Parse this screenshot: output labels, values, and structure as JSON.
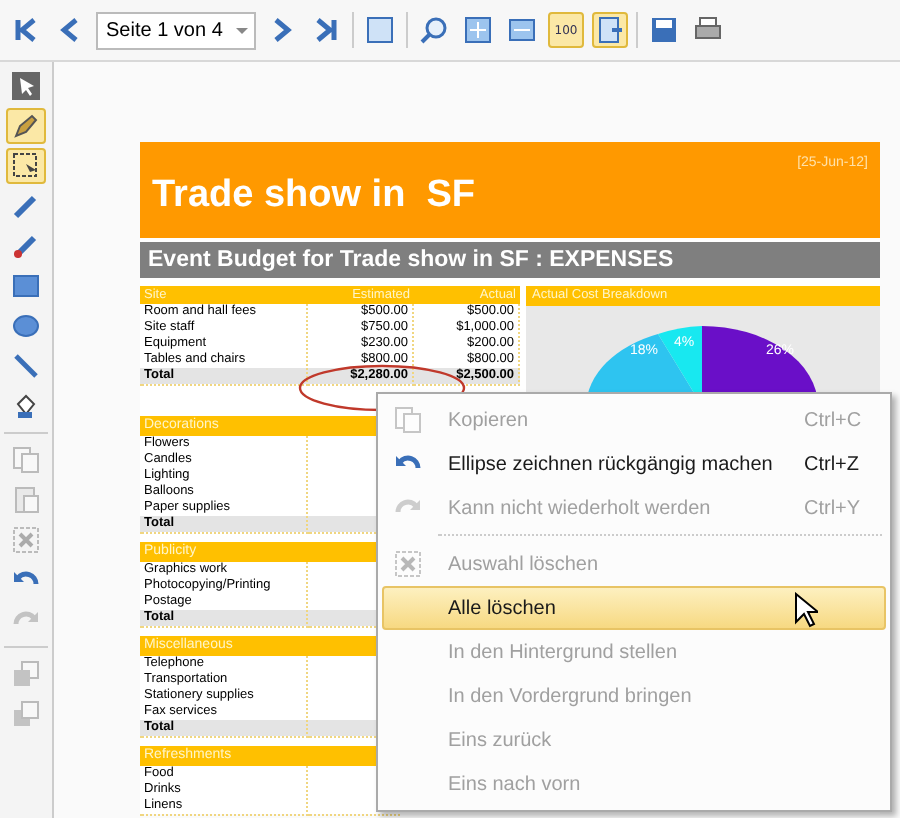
{
  "toolbar": {
    "page_select": {
      "value": "Seite 1 von 4"
    },
    "tools": [
      {
        "kind": "first",
        "selected": false
      },
      {
        "kind": "prev",
        "selected": false
      },
      {
        "kind": "page"
      },
      {
        "kind": "next",
        "selected": false
      },
      {
        "kind": "last",
        "selected": false
      },
      {
        "kind": "sep"
      },
      {
        "kind": "fitpage",
        "selected": false
      },
      {
        "kind": "sep"
      },
      {
        "kind": "zoom",
        "selected": false
      },
      {
        "kind": "fitall",
        "selected": false
      },
      {
        "kind": "fitwidth",
        "selected": false
      },
      {
        "kind": "actual",
        "selected": true,
        "label": "100"
      },
      {
        "kind": "autofit",
        "selected": true
      },
      {
        "kind": "sep"
      },
      {
        "kind": "save",
        "selected": false
      },
      {
        "kind": "print",
        "selected": false
      }
    ]
  },
  "side_tools": [
    {
      "kind": "pointer",
      "selected": false,
      "disabled": false
    },
    {
      "kind": "pen",
      "selected": true,
      "disabled": false
    },
    {
      "kind": "select",
      "selected": true,
      "disabled": false
    },
    {
      "kind": "pencil",
      "selected": false,
      "disabled": false
    },
    {
      "kind": "marker",
      "selected": false,
      "disabled": false
    },
    {
      "kind": "rect",
      "selected": false,
      "disabled": false
    },
    {
      "kind": "ellipse",
      "selected": false,
      "disabled": false
    },
    {
      "kind": "line",
      "selected": false,
      "disabled": false
    },
    {
      "kind": "fill",
      "selected": false,
      "disabled": false
    },
    {
      "kind": "sep"
    },
    {
      "kind": "copy",
      "selected": false,
      "disabled": true
    },
    {
      "kind": "paste",
      "selected": false,
      "disabled": true
    },
    {
      "kind": "delete",
      "selected": false,
      "disabled": true
    },
    {
      "kind": "undo",
      "selected": false,
      "disabled": false
    },
    {
      "kind": "redo",
      "selected": false,
      "disabled": true
    },
    {
      "kind": "sep"
    },
    {
      "kind": "back",
      "selected": false,
      "disabled": true
    },
    {
      "kind": "front",
      "selected": false,
      "disabled": true
    }
  ],
  "document": {
    "title": "Trade show in  SF",
    "date": "[25-Jun-12]",
    "subtitle": "Event Budget for Trade show in SF : EXPENSES",
    "site_table": {
      "columns": [
        "Site",
        "Estimated",
        "Actual"
      ],
      "rows": [
        [
          "Room and hall fees",
          "$500.00",
          "$500.00"
        ],
        [
          "Site staff",
          "$750.00",
          "$1,000.00"
        ],
        [
          "Equipment",
          "$230.00",
          "$200.00"
        ],
        [
          "Tables and chairs",
          "$800.00",
          "$800.00"
        ]
      ],
      "total": [
        "Total",
        "$2,280.00",
        "$2,500.00"
      ]
    },
    "sections": [
      {
        "header": "Decorations",
        "rows": [
          "Flowers",
          "Candles",
          "Lighting",
          "Balloons",
          "Paper supplies"
        ],
        "total": "Total"
      },
      {
        "header": "Publicity",
        "rows": [
          "Graphics work",
          "Photocopying/Printing",
          "Postage"
        ],
        "total": "Total"
      },
      {
        "header": "Miscellaneous",
        "rows": [
          "Telephone",
          "Transportation",
          "Stationery supplies",
          "Fax services"
        ],
        "total": "Total"
      },
      {
        "header": "Refreshments",
        "rows": [
          "Food",
          "Drinks",
          "Linens"
        ]
      }
    ],
    "chart": {
      "title": "Actual Cost Breakdown",
      "labels": [
        "18%",
        "4%",
        "26%"
      ]
    }
  },
  "context_menu": {
    "items": [
      {
        "kind": "copy",
        "label": "Kopieren",
        "shortcut": "Ctrl+C",
        "disabled": true,
        "selected": false
      },
      {
        "kind": "undo",
        "label": "Ellipse zeichnen rückgängig machen",
        "shortcut": "Ctrl+Z",
        "disabled": false,
        "selected": false
      },
      {
        "kind": "redo",
        "label": "Kann nicht wiederholt werden",
        "shortcut": "Ctrl+Y",
        "disabled": true,
        "selected": false
      },
      {
        "kind": "sep"
      },
      {
        "kind": "delete",
        "label": "Auswahl löschen",
        "disabled": true,
        "selected": false
      },
      {
        "kind": "plain",
        "label": "Alle löschen",
        "disabled": false,
        "selected": true
      },
      {
        "kind": "plain",
        "label": "In den Hintergrund stellen",
        "disabled": true,
        "selected": false
      },
      {
        "kind": "plain",
        "label": "In den Vordergrund bringen",
        "disabled": true,
        "selected": false
      },
      {
        "kind": "plain",
        "label": "Eins zurück",
        "disabled": true,
        "selected": false
      },
      {
        "kind": "plain",
        "label": "Eins nach vorn",
        "disabled": true,
        "selected": false
      }
    ]
  }
}
